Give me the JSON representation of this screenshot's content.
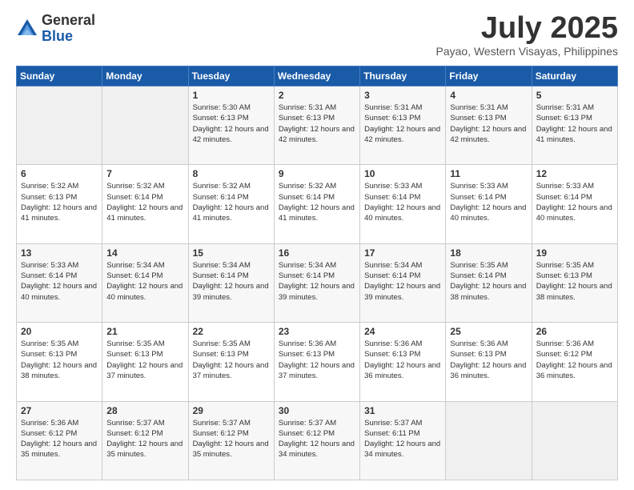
{
  "header": {
    "logo_general": "General",
    "logo_blue": "Blue",
    "month_title": "July 2025",
    "subtitle": "Payao, Western Visayas, Philippines"
  },
  "weekdays": [
    "Sunday",
    "Monday",
    "Tuesday",
    "Wednesday",
    "Thursday",
    "Friday",
    "Saturday"
  ],
  "weeks": [
    [
      {
        "day": "",
        "sunrise": "",
        "sunset": "",
        "daylight": ""
      },
      {
        "day": "",
        "sunrise": "",
        "sunset": "",
        "daylight": ""
      },
      {
        "day": "1",
        "sunrise": "Sunrise: 5:30 AM",
        "sunset": "Sunset: 6:13 PM",
        "daylight": "Daylight: 12 hours and 42 minutes."
      },
      {
        "day": "2",
        "sunrise": "Sunrise: 5:31 AM",
        "sunset": "Sunset: 6:13 PM",
        "daylight": "Daylight: 12 hours and 42 minutes."
      },
      {
        "day": "3",
        "sunrise": "Sunrise: 5:31 AM",
        "sunset": "Sunset: 6:13 PM",
        "daylight": "Daylight: 12 hours and 42 minutes."
      },
      {
        "day": "4",
        "sunrise": "Sunrise: 5:31 AM",
        "sunset": "Sunset: 6:13 PM",
        "daylight": "Daylight: 12 hours and 42 minutes."
      },
      {
        "day": "5",
        "sunrise": "Sunrise: 5:31 AM",
        "sunset": "Sunset: 6:13 PM",
        "daylight": "Daylight: 12 hours and 41 minutes."
      }
    ],
    [
      {
        "day": "6",
        "sunrise": "Sunrise: 5:32 AM",
        "sunset": "Sunset: 6:13 PM",
        "daylight": "Daylight: 12 hours and 41 minutes."
      },
      {
        "day": "7",
        "sunrise": "Sunrise: 5:32 AM",
        "sunset": "Sunset: 6:14 PM",
        "daylight": "Daylight: 12 hours and 41 minutes."
      },
      {
        "day": "8",
        "sunrise": "Sunrise: 5:32 AM",
        "sunset": "Sunset: 6:14 PM",
        "daylight": "Daylight: 12 hours and 41 minutes."
      },
      {
        "day": "9",
        "sunrise": "Sunrise: 5:32 AM",
        "sunset": "Sunset: 6:14 PM",
        "daylight": "Daylight: 12 hours and 41 minutes."
      },
      {
        "day": "10",
        "sunrise": "Sunrise: 5:33 AM",
        "sunset": "Sunset: 6:14 PM",
        "daylight": "Daylight: 12 hours and 40 minutes."
      },
      {
        "day": "11",
        "sunrise": "Sunrise: 5:33 AM",
        "sunset": "Sunset: 6:14 PM",
        "daylight": "Daylight: 12 hours and 40 minutes."
      },
      {
        "day": "12",
        "sunrise": "Sunrise: 5:33 AM",
        "sunset": "Sunset: 6:14 PM",
        "daylight": "Daylight: 12 hours and 40 minutes."
      }
    ],
    [
      {
        "day": "13",
        "sunrise": "Sunrise: 5:33 AM",
        "sunset": "Sunset: 6:14 PM",
        "daylight": "Daylight: 12 hours and 40 minutes."
      },
      {
        "day": "14",
        "sunrise": "Sunrise: 5:34 AM",
        "sunset": "Sunset: 6:14 PM",
        "daylight": "Daylight: 12 hours and 40 minutes."
      },
      {
        "day": "15",
        "sunrise": "Sunrise: 5:34 AM",
        "sunset": "Sunset: 6:14 PM",
        "daylight": "Daylight: 12 hours and 39 minutes."
      },
      {
        "day": "16",
        "sunrise": "Sunrise: 5:34 AM",
        "sunset": "Sunset: 6:14 PM",
        "daylight": "Daylight: 12 hours and 39 minutes."
      },
      {
        "day": "17",
        "sunrise": "Sunrise: 5:34 AM",
        "sunset": "Sunset: 6:14 PM",
        "daylight": "Daylight: 12 hours and 39 minutes."
      },
      {
        "day": "18",
        "sunrise": "Sunrise: 5:35 AM",
        "sunset": "Sunset: 6:14 PM",
        "daylight": "Daylight: 12 hours and 38 minutes."
      },
      {
        "day": "19",
        "sunrise": "Sunrise: 5:35 AM",
        "sunset": "Sunset: 6:13 PM",
        "daylight": "Daylight: 12 hours and 38 minutes."
      }
    ],
    [
      {
        "day": "20",
        "sunrise": "Sunrise: 5:35 AM",
        "sunset": "Sunset: 6:13 PM",
        "daylight": "Daylight: 12 hours and 38 minutes."
      },
      {
        "day": "21",
        "sunrise": "Sunrise: 5:35 AM",
        "sunset": "Sunset: 6:13 PM",
        "daylight": "Daylight: 12 hours and 37 minutes."
      },
      {
        "day": "22",
        "sunrise": "Sunrise: 5:35 AM",
        "sunset": "Sunset: 6:13 PM",
        "daylight": "Daylight: 12 hours and 37 minutes."
      },
      {
        "day": "23",
        "sunrise": "Sunrise: 5:36 AM",
        "sunset": "Sunset: 6:13 PM",
        "daylight": "Daylight: 12 hours and 37 minutes."
      },
      {
        "day": "24",
        "sunrise": "Sunrise: 5:36 AM",
        "sunset": "Sunset: 6:13 PM",
        "daylight": "Daylight: 12 hours and 36 minutes."
      },
      {
        "day": "25",
        "sunrise": "Sunrise: 5:36 AM",
        "sunset": "Sunset: 6:13 PM",
        "daylight": "Daylight: 12 hours and 36 minutes."
      },
      {
        "day": "26",
        "sunrise": "Sunrise: 5:36 AM",
        "sunset": "Sunset: 6:12 PM",
        "daylight": "Daylight: 12 hours and 36 minutes."
      }
    ],
    [
      {
        "day": "27",
        "sunrise": "Sunrise: 5:36 AM",
        "sunset": "Sunset: 6:12 PM",
        "daylight": "Daylight: 12 hours and 35 minutes."
      },
      {
        "day": "28",
        "sunrise": "Sunrise: 5:37 AM",
        "sunset": "Sunset: 6:12 PM",
        "daylight": "Daylight: 12 hours and 35 minutes."
      },
      {
        "day": "29",
        "sunrise": "Sunrise: 5:37 AM",
        "sunset": "Sunset: 6:12 PM",
        "daylight": "Daylight: 12 hours and 35 minutes."
      },
      {
        "day": "30",
        "sunrise": "Sunrise: 5:37 AM",
        "sunset": "Sunset: 6:12 PM",
        "daylight": "Daylight: 12 hours and 34 minutes."
      },
      {
        "day": "31",
        "sunrise": "Sunrise: 5:37 AM",
        "sunset": "Sunset: 6:11 PM",
        "daylight": "Daylight: 12 hours and 34 minutes."
      },
      {
        "day": "",
        "sunrise": "",
        "sunset": "",
        "daylight": ""
      },
      {
        "day": "",
        "sunrise": "",
        "sunset": "",
        "daylight": ""
      }
    ]
  ]
}
